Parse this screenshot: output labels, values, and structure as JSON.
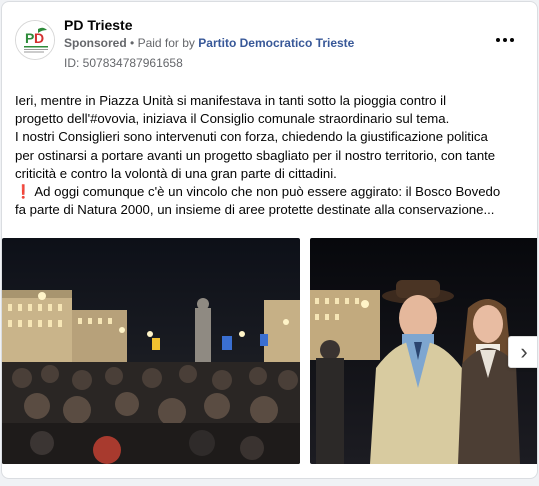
{
  "ad": {
    "page_name": "PD Trieste",
    "sponsored_label": "Sponsored",
    "separator": "•",
    "paid_for_prefix": "Paid for by",
    "payer": "Partito Democratico Trieste",
    "ad_id": "ID: 507834787961658",
    "logo_text": "Partito Democratico",
    "body": {
      "line1": "Ieri, mentre in Piazza Unità si manifestava in tanti sotto la pioggia contro il",
      "line2": "progetto dell'#ovovia, iniziava il Consiglio comunale straordinario sul tema.",
      "line3": "I nostri Consiglieri sono intervenuti con forza, chiedendo la giustificazione politica",
      "line4": "per ostinarsi a portare avanti un progetto sbagliato per il nostro territorio, con tante",
      "line5": "criticità e contro la volontà di una gran parte di cittadini.",
      "warning_icon": "❗",
      "line6": " Ad oggi comunque c'è un vincolo che non può essere aggirato: il Bosco Bovedo",
      "line7": "fa parte di Natura 2000, un insieme di aree protette destinate alla conservazione..."
    },
    "carousel": {
      "next_glyph": "›",
      "slides": [
        "crowd-photo",
        "portrait-photo"
      ]
    },
    "colors": {
      "brand_green": "#2e8b3a",
      "brand_red": "#d32f2f",
      "link_blue": "#385898",
      "muted": "#65676b"
    }
  }
}
